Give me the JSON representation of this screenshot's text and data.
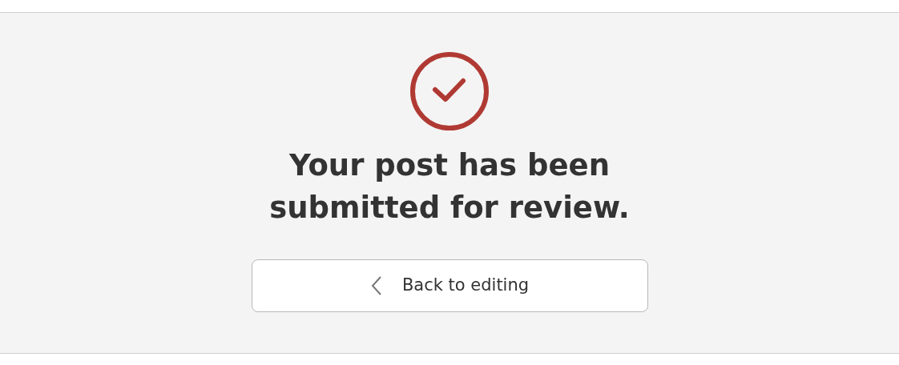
{
  "confirmation": {
    "heading": "Your post has been submitted for review.",
    "button": "Back to editing"
  }
}
